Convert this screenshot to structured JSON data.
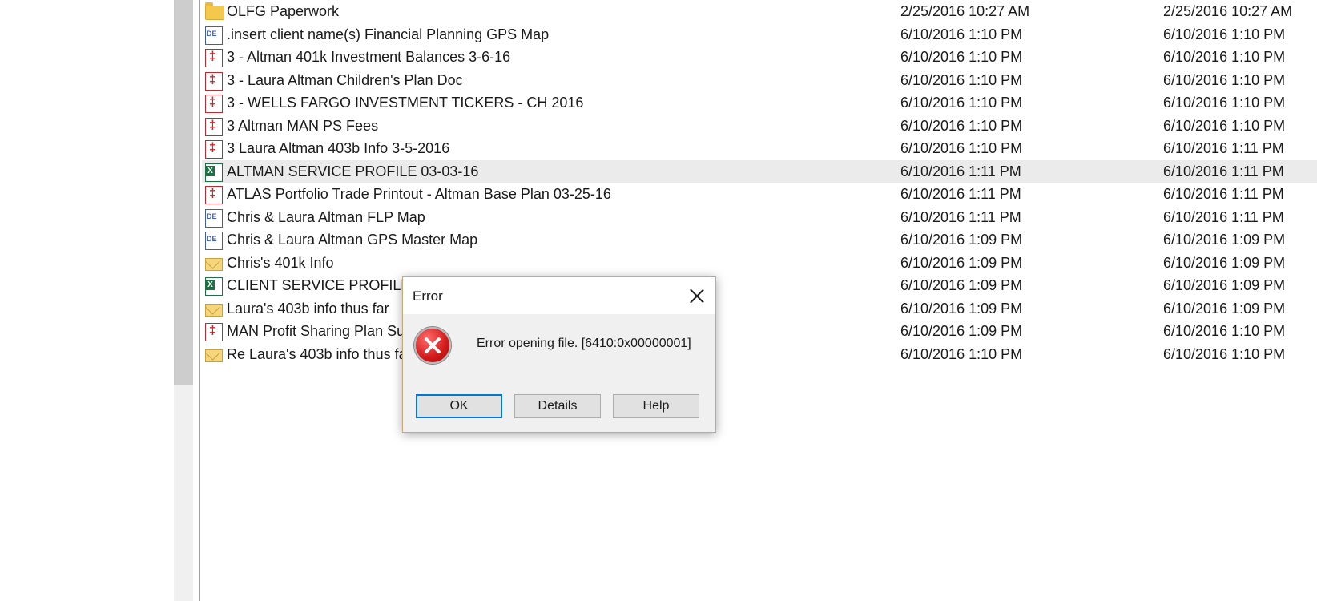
{
  "files": [
    {
      "name": "OLFG Paperwork",
      "icon": "folder-icon",
      "date1": "2/25/2016 10:27 AM",
      "date2": "2/25/2016 10:27 AM"
    },
    {
      "name": ".insert client name(s) Financial Planning GPS Map",
      "icon": "mindmap-doc-icon",
      "date1": "6/10/2016 1:10 PM",
      "date2": "6/10/2016 1:10 PM"
    },
    {
      "name": "3 - Altman 401k Investment Balances 3-6-16",
      "icon": "pdf-icon",
      "date1": "6/10/2016 1:10 PM",
      "date2": "6/10/2016 1:10 PM"
    },
    {
      "name": "3 - Laura Altman Children's Plan Doc",
      "icon": "pdf-icon",
      "date1": "6/10/2016 1:10 PM",
      "date2": "6/10/2016 1:10 PM"
    },
    {
      "name": "3 - WELLS FARGO INVESTMENT TICKERS - CH 2016",
      "icon": "pdf-icon",
      "date1": "6/10/2016 1:10 PM",
      "date2": "6/10/2016 1:10 PM"
    },
    {
      "name": "3 Altman MAN PS Fees",
      "icon": "pdf-icon",
      "date1": "6/10/2016 1:10 PM",
      "date2": "6/10/2016 1:10 PM"
    },
    {
      "name": "3 Laura Altman 403b Info 3-5-2016",
      "icon": "pdf-icon",
      "date1": "6/10/2016 1:10 PM",
      "date2": "6/10/2016 1:11 PM"
    },
    {
      "name": "ALTMAN SERVICE PROFILE 03-03-16",
      "icon": "excel-icon",
      "date1": "6/10/2016 1:11 PM",
      "date2": "6/10/2016 1:11 PM",
      "selected": true
    },
    {
      "name": "ATLAS Portfolio Trade Printout - Altman Base Plan 03-25-16",
      "icon": "pdf-icon",
      "date1": "6/10/2016 1:11 PM",
      "date2": "6/10/2016 1:11 PM"
    },
    {
      "name": "Chris & Laura Altman FLP Map",
      "icon": "mindmap-doc-icon",
      "date1": "6/10/2016 1:11 PM",
      "date2": "6/10/2016 1:11 PM"
    },
    {
      "name": "Chris & Laura Altman GPS Master Map",
      "icon": "mindmap-doc-icon",
      "date1": "6/10/2016 1:09 PM",
      "date2": "6/10/2016 1:09 PM"
    },
    {
      "name": "Chris's 401k Info",
      "icon": "mail-icon",
      "date1": "6/10/2016 1:09 PM",
      "date2": "6/10/2016 1:09 PM"
    },
    {
      "name": "CLIENT SERVICE PROFILE M",
      "icon": "excel-icon",
      "date1": "6/10/2016 1:09 PM",
      "date2": "6/10/2016 1:09 PM"
    },
    {
      "name": "Laura's 403b info thus far",
      "icon": "mail-icon",
      "date1": "6/10/2016 1:09 PM",
      "date2": "6/10/2016 1:09 PM"
    },
    {
      "name": "MAN Profit Sharing Plan Su",
      "icon": "pdf-icon",
      "date1": "6/10/2016 1:09 PM",
      "date2": "6/10/2016 1:10 PM"
    },
    {
      "name": "Re  Laura's 403b info thus fa",
      "icon": "mail-icon",
      "date1": "6/10/2016 1:10 PM",
      "date2": "6/10/2016 1:10 PM"
    }
  ],
  "dialog": {
    "title": "Error",
    "message": "Error opening file. [6410:0x00000001]",
    "icon": "error-icon",
    "buttons": {
      "ok": "OK",
      "details": "Details",
      "help": "Help"
    }
  },
  "colors": {
    "selected_row": "#ebebeb",
    "focus_border": "#0078d7",
    "error_red": "#d11a1a"
  }
}
